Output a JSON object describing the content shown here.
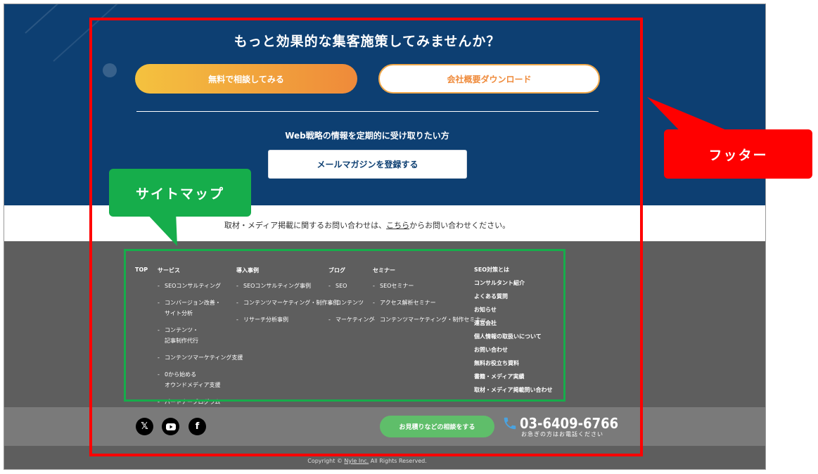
{
  "cta": {
    "title": "もっと効果的な集客施策してみませんか？",
    "consult_button": "無料で相談してみる",
    "download_button": "会社概要ダウンロード",
    "newsletter_heading": "Web戦略の情報を定期的に受け取りたい方",
    "newsletter_button": "メールマガジンを登録する"
  },
  "press": {
    "before": "取材・メディア掲載に関するお問い合わせは、",
    "link": "こちら",
    "after": "からお問い合わせください。"
  },
  "sitemap": {
    "top": "TOP",
    "services": {
      "head": "サービス",
      "items": [
        [
          "SEOコンサルティング"
        ],
        [
          "コンバージョン改善・",
          "サイト分析"
        ],
        [
          "コンテンツ・",
          "記事制作代行"
        ],
        [
          "コンテンツマーケティング支援"
        ],
        [
          "0から始める",
          "オウンドメディア支援"
        ],
        [
          "パートナープログラム"
        ]
      ]
    },
    "cases": {
      "head": "導入事例",
      "items": [
        "SEOコンサルティング事例",
        "コンテンツマーケティング・制作事例",
        "リサーチ分析事例"
      ]
    },
    "blog": {
      "head": "ブログ",
      "items": [
        "SEO",
        "コンテンツ",
        "マーケティング"
      ]
    },
    "seminar": {
      "head": "セミナー",
      "items": [
        "SEOセミナー",
        "アクセス解析セミナー",
        "コンテンツマーケティング・制作セミナー"
      ]
    },
    "right_links": [
      "SEO対策とは",
      "コンサルタント紹介",
      "よくある質問",
      "お知らせ",
      "運営会社",
      "個人情報の取扱いについて",
      "お問い合わせ",
      "無料お役立ち資料",
      "書籍・メディア実績",
      "取材・メディア掲載問い合わせ"
    ]
  },
  "social": {
    "icons": [
      "x-icon",
      "youtube-icon",
      "facebook-icon"
    ],
    "estimate_button": "お見積りなどの相談をする",
    "phone": "03-6409-6766",
    "phone_note": "お急ぎの方はお電話ください"
  },
  "copyright": {
    "before": "Copyright © ",
    "company": "Nyle Inc.",
    "after": " All Rights Reserved."
  },
  "annotations": {
    "footer_label": "フッター",
    "sitemap_label": "サイトマップ"
  },
  "colors": {
    "navy": "#0d3f72",
    "orange_start": "#f4c23f",
    "orange_end": "#ef8a3a",
    "green_button": "#5fbe6a",
    "annotation_red": "#ff0000",
    "annotation_green": "#16ad4b"
  }
}
